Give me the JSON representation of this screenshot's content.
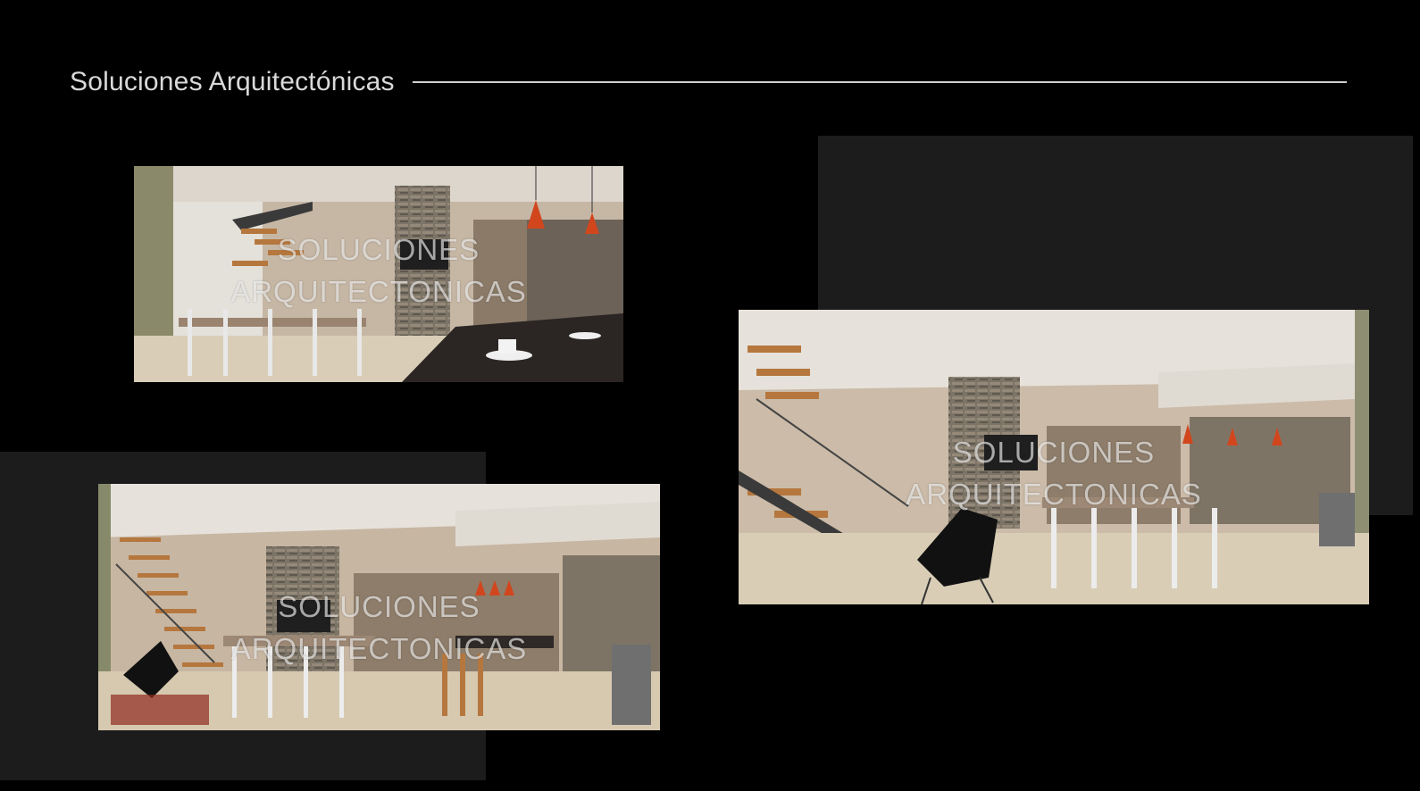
{
  "header": {
    "title": "Soluciones Arquitectónicas"
  },
  "renders": [
    {
      "id": "dining-kitchen-view",
      "watermark_line1": "SOLUCIONES",
      "watermark_line2": "ARQUITECTONICAS"
    },
    {
      "id": "open-plan-wide-view",
      "watermark_line1": "SOLUCIONES",
      "watermark_line2": "ARQUITECTONICAS"
    },
    {
      "id": "stair-living-view",
      "watermark_line1": "SOLUCIONES",
      "watermark_line2": "ARQUITECTONICAS"
    }
  ],
  "colors": {
    "background": "#000000",
    "panel": "#1c1c1c",
    "title": "#d9d9d9",
    "wall": "#c9b8a4",
    "floor": "#d8ccb4",
    "pendant": "#d2461e"
  }
}
